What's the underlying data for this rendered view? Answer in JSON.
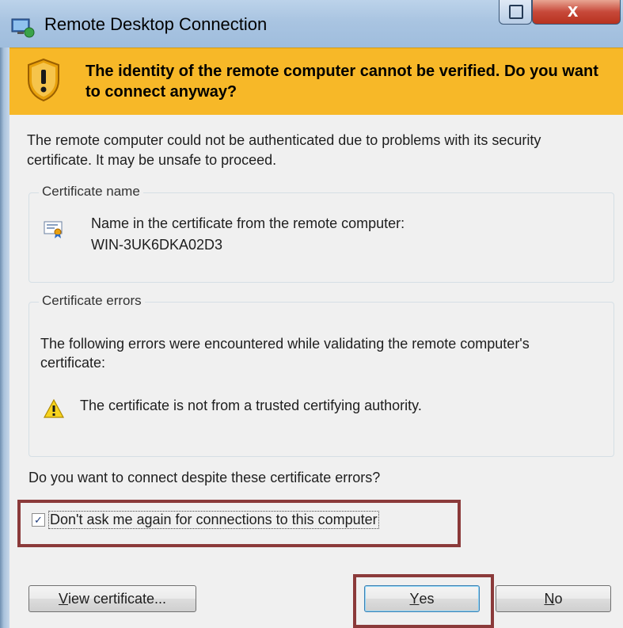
{
  "window": {
    "title": "Remote Desktop Connection"
  },
  "banner": {
    "message": "The identity of the remote computer cannot be verified. Do you want to connect anyway?"
  },
  "intro": "The remote computer could not be authenticated due to problems with its security certificate. It may be unsafe to proceed.",
  "certificate_name_group": {
    "legend": "Certificate name",
    "label": "Name in the certificate from the remote computer:",
    "value": "WIN-3UK6DKA02D3"
  },
  "certificate_errors_group": {
    "legend": "Certificate errors",
    "description": "The following errors were encountered while validating the remote computer's certificate:",
    "errors": [
      "The certificate is not from a trusted certifying authority."
    ]
  },
  "question": "Do you want to connect despite these certificate errors?",
  "checkbox": {
    "label": "Don't ask me again for connections to this computer",
    "checked": true
  },
  "buttons": {
    "view_certificate": {
      "prefix": "V",
      "rest": "iew certificate..."
    },
    "yes": {
      "prefix": "Y",
      "rest": "es"
    },
    "no": {
      "prefix": "N",
      "rest": "o"
    }
  },
  "colors": {
    "banner": "#f7b828",
    "highlight": "#8b3a3a",
    "titlebar": "#a9c4e1"
  }
}
